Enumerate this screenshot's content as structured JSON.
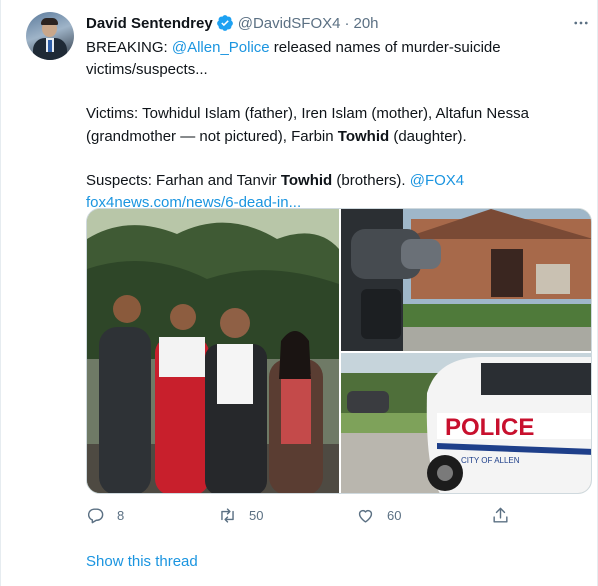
{
  "tweet": {
    "author_name": "David Sentendrey",
    "author_handle": "@DavidSFOX4",
    "separator": "·",
    "time": "20h",
    "line1_pre": "BREAKING: ",
    "line1_mention": "@Allen_Police",
    "line1_post": " released names of murder-suicide victims/suspects...",
    "victims_pre": "Victims: Towhidul Islam (father), Iren Islam (mother), Altafun Nessa (grandmother — not pictured), Farbin ",
    "victims_bold": "Towhid",
    "victims_post": " (daughter).",
    "suspects_pre": "Suspects: Farhan and Tanvir ",
    "suspects_bold": "Towhid",
    "suspects_post": " (brothers). ",
    "suspects_mention": "@FOX4",
    "url": "fox4news.com/news/6-dead-in...",
    "police_text": "POLICE",
    "police_city": "CITY OF ALLEN"
  },
  "actions": {
    "replies": "8",
    "retweets": "50",
    "likes": "60"
  },
  "show_thread": "Show this thread",
  "colors": {
    "link": "#1b95e0",
    "secondary": "#5b7083",
    "verified": "#1da1f2"
  },
  "icons": [
    "verified-badge-icon",
    "more-icon",
    "reply-icon",
    "retweet-icon",
    "like-icon",
    "share-icon"
  ]
}
